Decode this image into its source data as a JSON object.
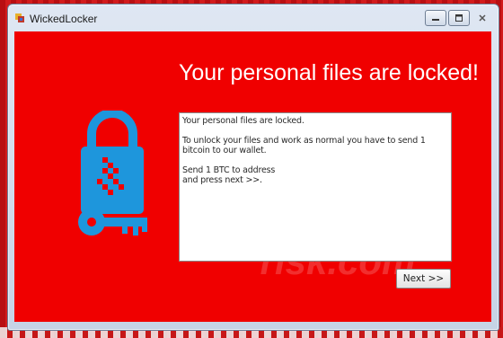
{
  "window": {
    "title": "WickedLocker"
  },
  "main": {
    "headline": "Your personal files are locked!",
    "message": {
      "line1": "Your personal files are locked.",
      "line2": "To unlock your files and work as normal you have to send 1 bitcoin to our wallet.",
      "line3a": "Send 1 BTC to address",
      "line3b": "and press next >>."
    },
    "next_label": "Next >>"
  },
  "colors": {
    "background": "#f00000",
    "lock_icon": "#1e96dc",
    "headline": "#ffffff"
  },
  "icons": {
    "app": "lock-app-icon",
    "main": "padlock-key-icon"
  }
}
